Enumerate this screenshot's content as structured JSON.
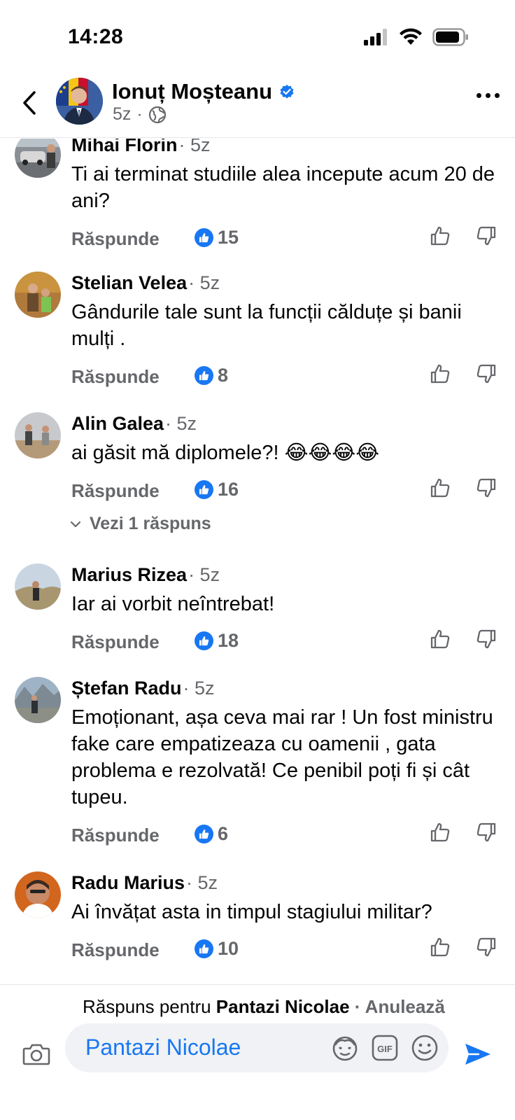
{
  "status_bar": {
    "time": "14:28"
  },
  "header": {
    "author": "Ionuț Moșteanu",
    "age": "5z",
    "separator": "·",
    "verified_icon": "verified-badge-icon",
    "privacy_icon": "globe-icon"
  },
  "comments": [
    {
      "name": "Mihai Florin",
      "time": "· 5z",
      "text": "Ti ai terminat studiile alea incepute acum  20 de ani?",
      "reply": "Răspunde",
      "likes": "15"
    },
    {
      "name": "Stelian Velea",
      "time": "· 5z",
      "text": "Gândurile tale sunt la funcții călduțe și banii mulți .",
      "reply": "Răspunde",
      "likes": "8"
    },
    {
      "name": "Alin Galea",
      "time": "· 5z",
      "text": "ai găsit mă diplomele?! 😂😂😂😂",
      "reply": "Răspunde",
      "likes": "16",
      "view_replies": "Vezi 1 răspuns"
    },
    {
      "name": "Marius Rizea",
      "time": "· 5z",
      "text": "Iar ai vorbit neîntrebat!",
      "reply": "Răspunde",
      "likes": "18"
    },
    {
      "name": "Ștefan Radu",
      "time": "· 5z",
      "text": "Emoționant, așa ceva mai rar ! Un fost ministru fake care empatizeaza cu oamenii , gata problema e rezolvată! Ce penibil poți fi și cât tupeu.",
      "reply": "Răspunde",
      "likes": "6"
    },
    {
      "name": "Radu Marius",
      "time": "· 5z",
      "text": "Ai învățat asta in timpul stagiului militar?",
      "reply": "Răspunde",
      "likes": "10"
    }
  ],
  "composer": {
    "reply_prefix": "Răspuns pentru ",
    "reply_to": "Pantazi Nicolae",
    "cancel": " · Anulează",
    "input_value": "Pantazi Nicolae",
    "gif_label": "GIF"
  },
  "colors": {
    "accent": "#1877f2",
    "secondary_text": "#65676b",
    "text": "#050505"
  }
}
